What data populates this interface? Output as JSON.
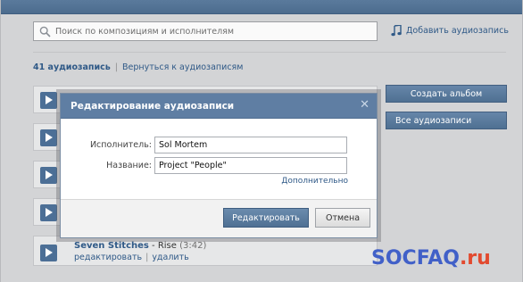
{
  "search": {
    "placeholder": "Поиск по композициям и исполнителям"
  },
  "header": {
    "add_audio_label": "Добавить аудиозапись"
  },
  "breadcrumb": {
    "count": "41 аудиозапись",
    "separator": "|",
    "back_label": "Вернуться к аудиозаписям"
  },
  "sidebar": {
    "create_album": "Создать альбом",
    "all_audio": "Все аудиозаписи"
  },
  "dialog": {
    "title": "Редактирование аудиозаписи",
    "close_glyph": "✕",
    "artist_label": "Исполнитель:",
    "artist_value": "Sol Mortem",
    "title_label": "Название:",
    "title_value": "Project \"People\"",
    "more_link": "Дополнительно",
    "submit_label": "Редактировать",
    "cancel_label": "Отмена"
  },
  "track": {
    "artist": "Seven Stitches",
    "dash": " - ",
    "title": "Rise",
    "duration": "(3:42)",
    "edit_label": "редактировать",
    "separator": "|",
    "delete_label": "удалить"
  },
  "watermark": {
    "part1": "SOCFAQ",
    "part2": ".ru"
  },
  "colors": {
    "accent": "#5f7ea3",
    "link": "#2f5987",
    "watermark_blue": "#4160c8",
    "watermark_red": "#e24a2f"
  },
  "icons": {
    "search": "search-icon",
    "note": "music-note-icon",
    "play": "play-icon",
    "close": "close-icon"
  }
}
